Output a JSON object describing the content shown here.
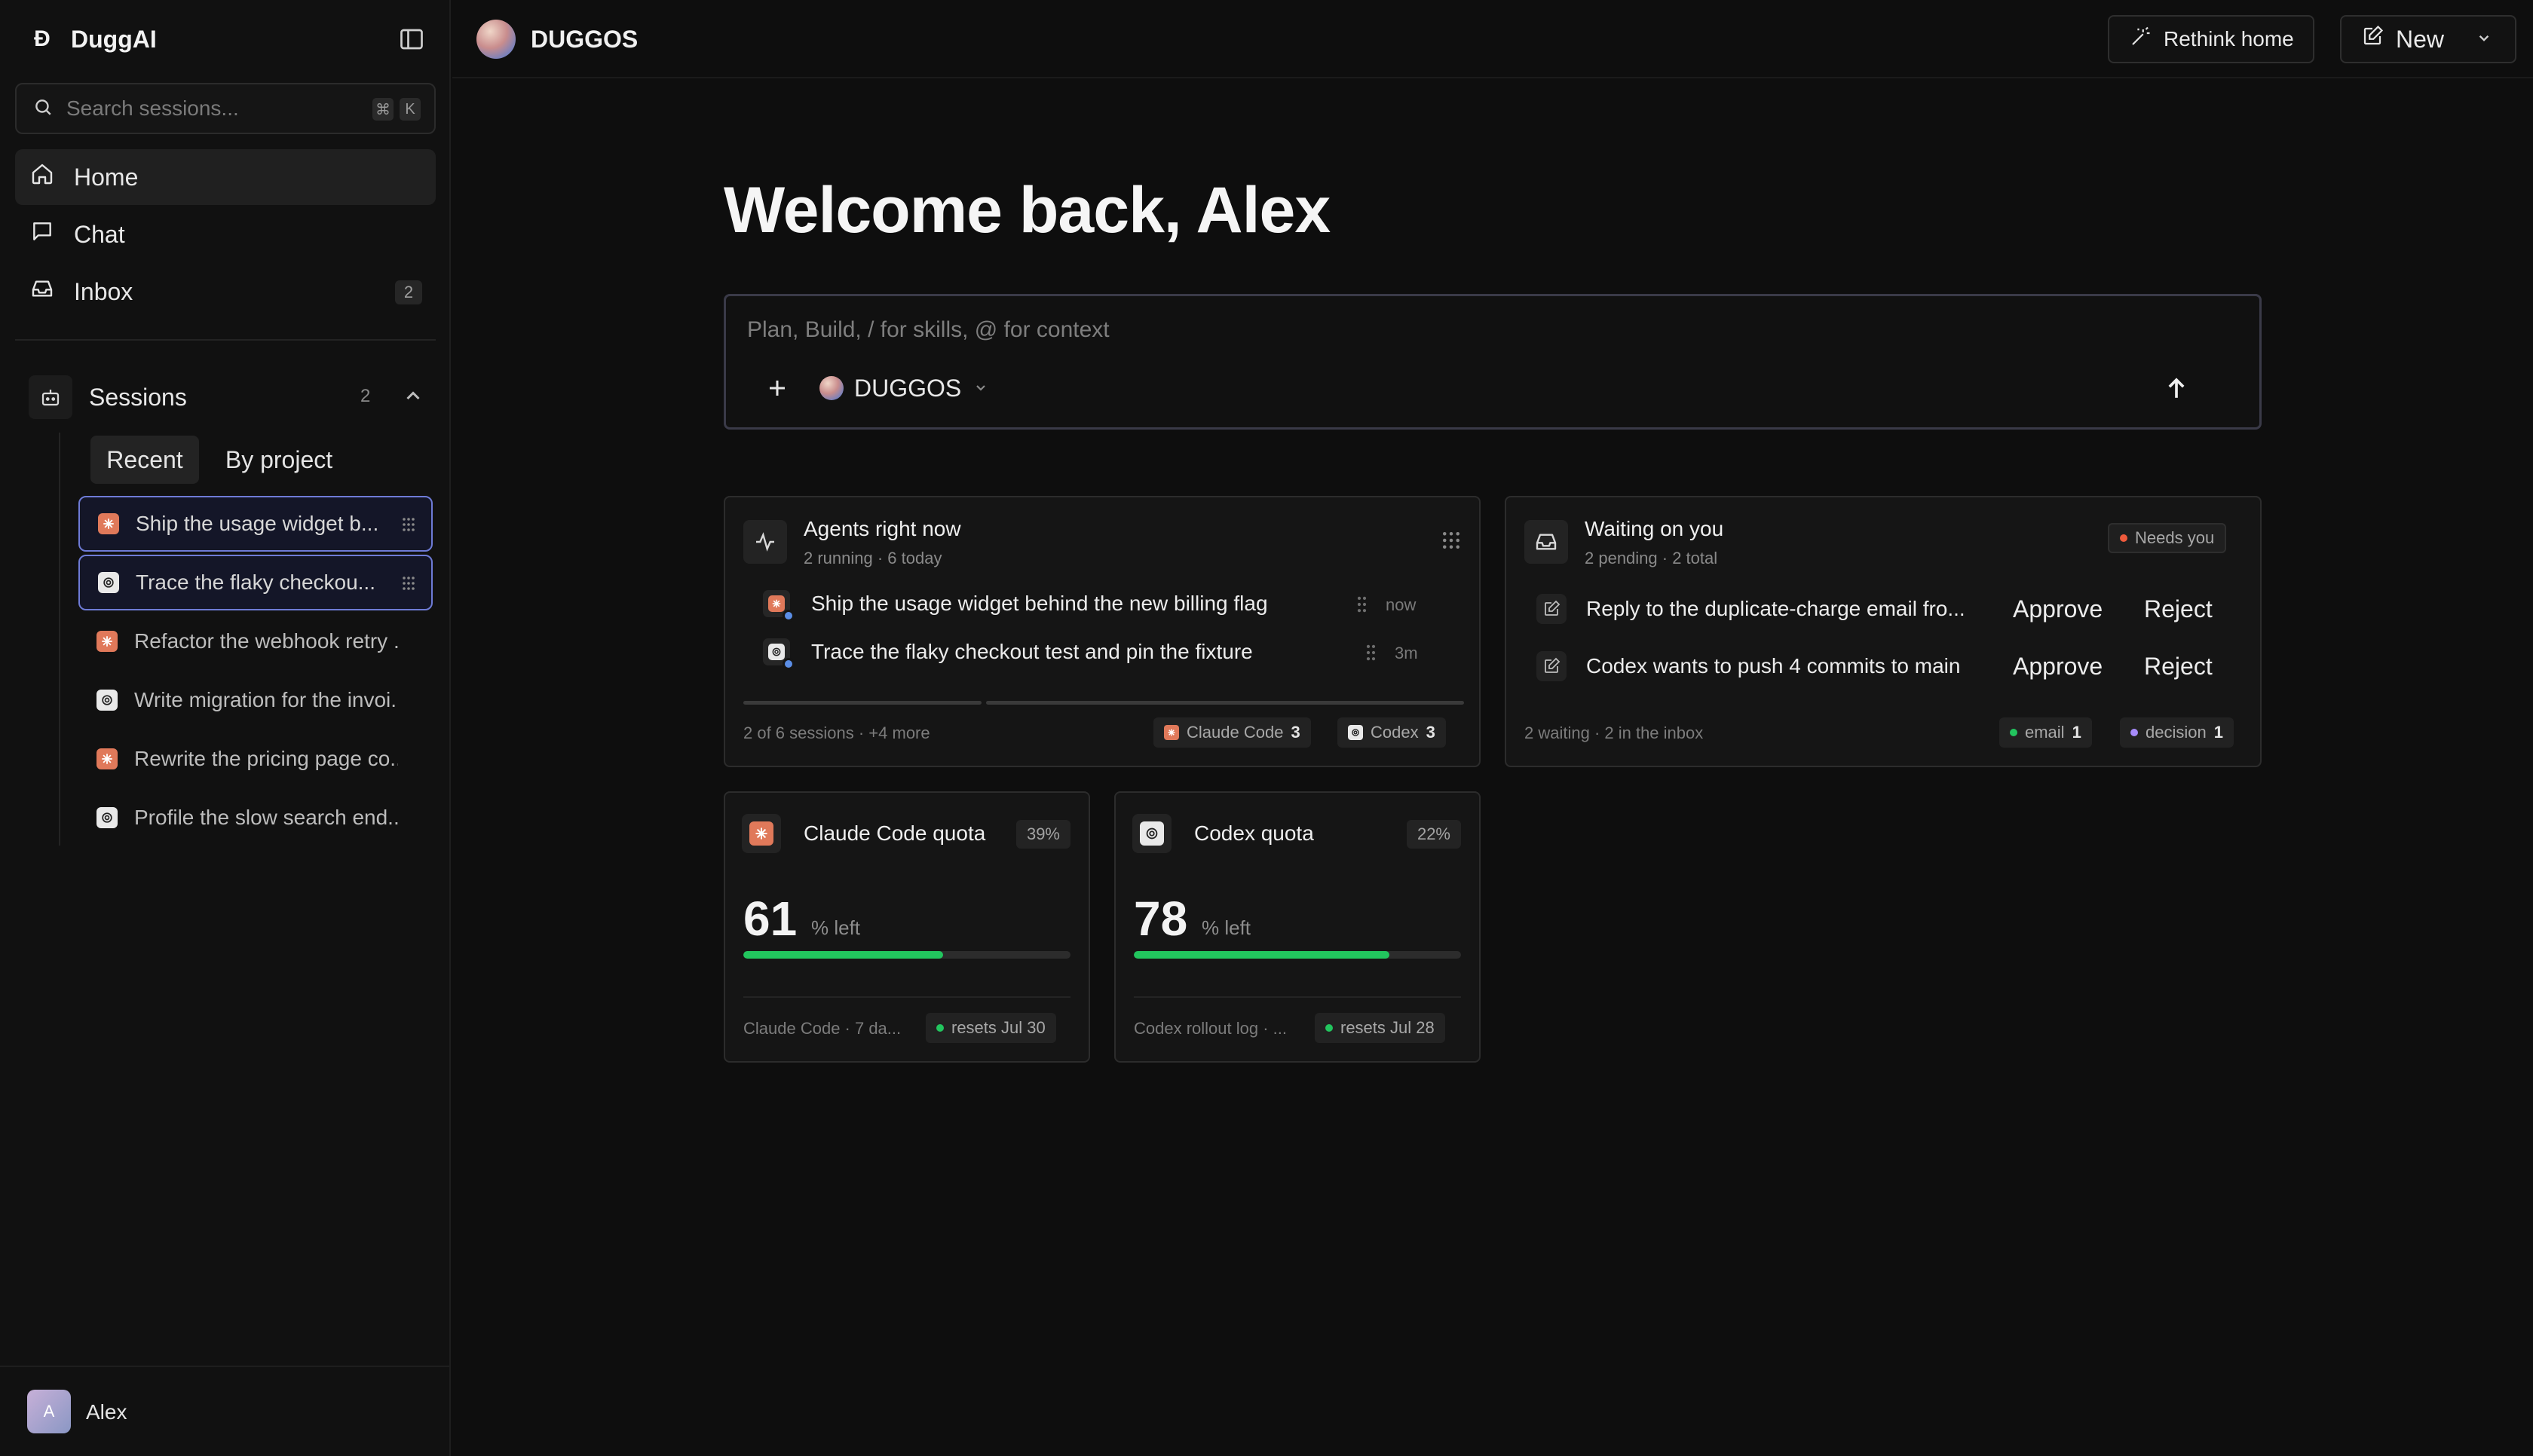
{
  "app": {
    "name": "DuggAI",
    "logo_glyph": "Ɖ"
  },
  "sidebar": {
    "search": {
      "placeholder": "Search sessions...",
      "kbd_mod": "⌘",
      "kbd_key": "K"
    },
    "nav": [
      {
        "label": "Home",
        "icon": "home-icon",
        "active": true
      },
      {
        "label": "Chat",
        "icon": "chat-icon"
      },
      {
        "label": "Inbox",
        "icon": "inbox-icon",
        "badge": "2"
      }
    ],
    "sessions": {
      "label": "Sessions",
      "count": "2",
      "tabs": [
        "Recent",
        "By project"
      ],
      "active_tab": "Recent",
      "items": [
        {
          "label": "Ship the usage widget b...",
          "provider": "claude",
          "selected": true
        },
        {
          "label": "Trace the flaky checkou...",
          "provider": "codex",
          "selected": true
        },
        {
          "label": "Refactor the webhook retry ...",
          "provider": "claude"
        },
        {
          "label": "Write migration for the invoi...",
          "provider": "codex"
        },
        {
          "label": "Rewrite the pricing page co...",
          "provider": "claude"
        },
        {
          "label": "Profile the slow search end...",
          "provider": "codex"
        }
      ]
    },
    "user": {
      "initial": "A",
      "name": "Alex"
    }
  },
  "topbar": {
    "workspace": "DUGGOS",
    "rethink_label": "Rethink home",
    "new_label": "New"
  },
  "main": {
    "welcome": "Welcome back, Alex",
    "composer": {
      "placeholder": "Plan, Build, / for skills, @ for context",
      "workspace": "DUGGOS"
    },
    "agents": {
      "title": "Agents right now",
      "subtitle": "2 running · 6 today",
      "rows": [
        {
          "text": "Ship the usage widget behind the new billing flag",
          "time": "now",
          "provider": "claude"
        },
        {
          "text": "Trace the flaky checkout test and pin the fixture",
          "time": "3m",
          "provider": "codex"
        }
      ],
      "footer": "2 of 6 sessions · +4 more",
      "chips": [
        {
          "label": "Claude Code",
          "count": "3",
          "provider": "claude"
        },
        {
          "label": "Codex",
          "count": "3",
          "provider": "codex"
        }
      ]
    },
    "waiting": {
      "title": "Waiting on you",
      "subtitle": "2 pending · 2 total",
      "badge": "Needs you",
      "rows": [
        {
          "text": "Reply to the duplicate-charge email fro...",
          "approve": "Approve",
          "reject": "Reject"
        },
        {
          "text": "Codex wants to push 4 commits to main",
          "approve": "Approve",
          "reject": "Reject"
        }
      ],
      "footer": "2 waiting · 2 in the inbox",
      "chips": [
        {
          "label": "email",
          "count": "1",
          "color": "#22c55e"
        },
        {
          "label": "decision",
          "count": "1",
          "color": "#a78bfa"
        }
      ]
    },
    "quotas": [
      {
        "title": "Claude Code quota",
        "used_pct": "39%",
        "left": "61",
        "unit": "% left",
        "left_fraction": 0.61,
        "footer": "Claude Code · 7 da...",
        "reset": "resets Jul 30",
        "provider": "claude"
      },
      {
        "title": "Codex quota",
        "used_pct": "22%",
        "left": "78",
        "unit": "% left",
        "left_fraction": 0.78,
        "footer": "Codex rollout log · ...",
        "reset": "resets Jul 28",
        "provider": "codex"
      }
    ]
  },
  "colors": {
    "accent_selected": "#6e7bd6",
    "claude": "#e0795a",
    "codex": "#e9e9e9",
    "progress": "#22c55e",
    "needs_you_dot": "#ef5a3c",
    "running_dot": "#5b8ee6"
  }
}
